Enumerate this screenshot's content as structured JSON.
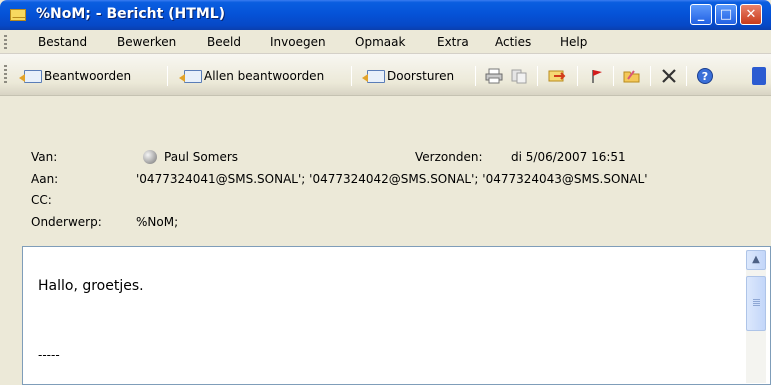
{
  "window": {
    "title": "%NoM; - Bericht (HTML)",
    "minimize_label": "_",
    "maximize_label": "□",
    "close_label": "✕"
  },
  "menu": {
    "items": [
      "Bestand",
      "Bewerken",
      "Beeld",
      "Invoegen",
      "Opmaak",
      "Extra",
      "Acties",
      "Help"
    ]
  },
  "toolbar": {
    "reply_label": "Beantwoorden",
    "reply_all_label": "Allen beantwoorden",
    "forward_label": "Doorsturen",
    "print_icon": "printer-icon",
    "copy_icon": "copy-icon",
    "move_icon": "move-to-folder-icon",
    "flag_icon": "flag-icon",
    "folder_icon": "folder-icon",
    "delete_icon": "delete-icon",
    "help_icon": "help-icon"
  },
  "header": {
    "from_label": "Van:",
    "from_value": "Paul Somers",
    "sent_label": "Verzonden:",
    "sent_value": "di 5/06/2007 16:51",
    "to_label": "Aan:",
    "to_value": "'0477324041@SMS.SONAL'; '0477324042@SMS.SONAL'; '0477324043@SMS.SONAL'",
    "cc_label": "CC:",
    "cc_value": "",
    "subject_label": "Onderwerp:",
    "subject_value": "%NoM;"
  },
  "body": {
    "text": "Hallo, groetjes.",
    "signature_separator": "-----"
  },
  "colors": {
    "titlebar": "#0553d8",
    "chrome": "#ece9d8",
    "close_button": "#c93b1b"
  }
}
